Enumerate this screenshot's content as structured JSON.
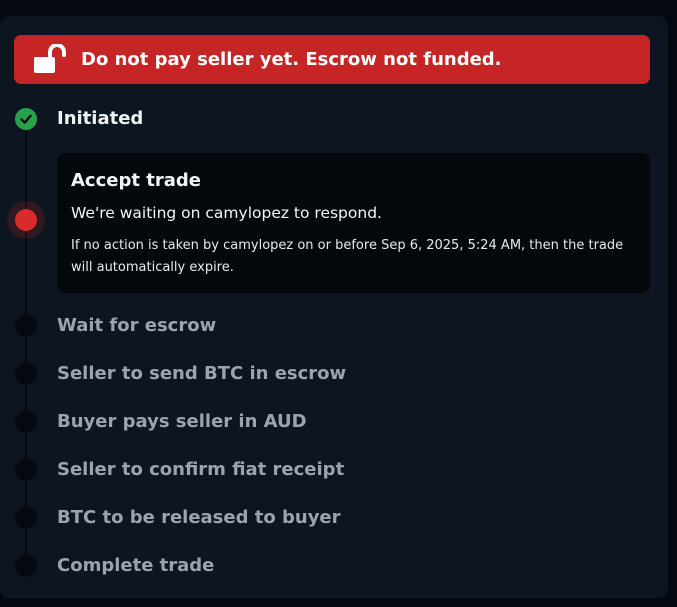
{
  "alert": {
    "icon": "unlocked-lock-icon",
    "text": "Do not pay seller yet. Escrow not funded.",
    "color": "#c62525"
  },
  "steps": [
    {
      "label": "Initiated",
      "status": "done",
      "icon": "check-icon"
    },
    {
      "label": "Accept trade",
      "status": "active"
    },
    {
      "label": "Wait for escrow",
      "status": "pending"
    },
    {
      "label": "Seller to send BTC in escrow",
      "status": "pending"
    },
    {
      "label": "Buyer pays seller in AUD",
      "status": "pending"
    },
    {
      "label": "Seller to confirm fiat receipt",
      "status": "pending"
    },
    {
      "label": "BTC to be released to buyer",
      "status": "pending"
    },
    {
      "label": "Complete trade",
      "status": "pending"
    }
  ],
  "active_card": {
    "title": "Accept trade",
    "subtitle": "We're waiting on camylopez to respond.",
    "note": "If no action is taken by camylopez on or before Sep 6, 2025, 5:24 AM, then the trade will automatically expire."
  },
  "colors": {
    "done": "#27a24a",
    "active": "#d92b2b",
    "pending": "#05090f"
  }
}
